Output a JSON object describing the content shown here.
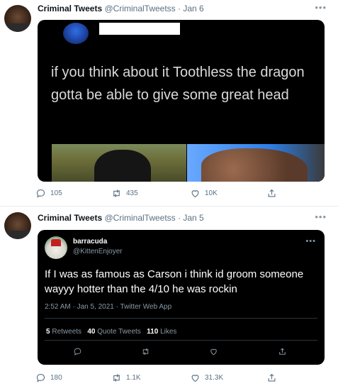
{
  "tweets": [
    {
      "author_name": "Criminal Tweets",
      "author_handle": "@CriminalTweetss",
      "separator": "·",
      "date": "Jan 6",
      "more": "•••",
      "embedded_text": "if you think about it Toothless the dragon gotta be able to give some great head",
      "replies": "105",
      "retweets": "435",
      "likes": "10K"
    },
    {
      "author_name": "Criminal Tweets",
      "author_handle": "@CriminalTweetss",
      "separator": "·",
      "date": "Jan 5",
      "more": "•••",
      "quoted": {
        "name": "barracuda",
        "handle": "@KittenEnjoyer",
        "more": "•••",
        "text": "If I was as famous as Carson i think id groom someone wayyy hotter than the 4/10 he was rockin",
        "meta": "2:52 AM · Jan 5, 2021 · Twitter Web App",
        "retweets_count": "5",
        "retweets_label": "Retweets",
        "quotes_count": "40",
        "quotes_label": "Quote Tweets",
        "likes_count": "110",
        "likes_label": "Likes"
      },
      "replies": "180",
      "retweets": "1.1K",
      "likes": "31.3K"
    }
  ],
  "icons": [
    "reply-icon",
    "retweet-icon",
    "like-icon",
    "share-icon"
  ],
  "colors": {
    "muted": "#5b7083",
    "card_bg": "#000000",
    "divider": "#e6ecf0"
  }
}
